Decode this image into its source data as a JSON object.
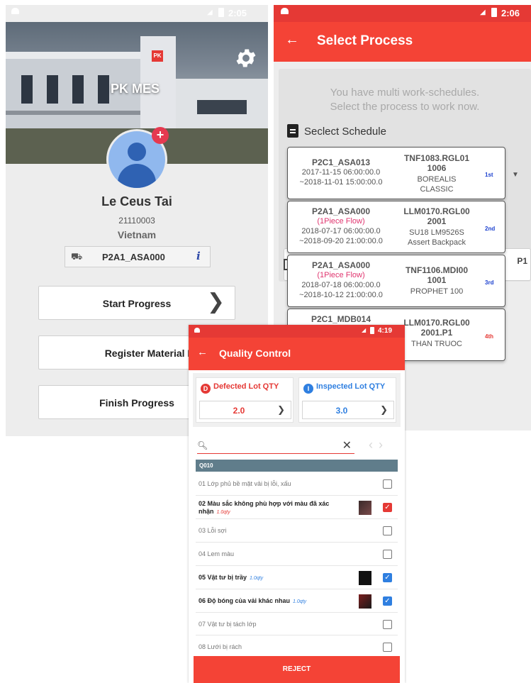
{
  "profile": {
    "status_time": "2:05",
    "app_name": "PK MES",
    "logo_text": "PK",
    "user_name": "Le Ceus Tai",
    "user_id": "21110003",
    "country": "Vietnam",
    "process": "P2A1_ASA000",
    "info_glyph": "i",
    "buttons": {
      "start": "Start Progress",
      "register": "Register Material Failure",
      "finish": "Finish Progress"
    },
    "icons": [
      "gear-icon",
      "avatar-icon",
      "add-icon",
      "machine-icon",
      "info-icon",
      "chevron-right-icon"
    ]
  },
  "select_process": {
    "status_time": "2:06",
    "title": "Select Process",
    "notice_line1": "You have multi work-schedules.",
    "notice_line2": "Select the process to work now.",
    "schedule_label": "Seclect Schedule",
    "behind_partial": "P1",
    "schedules": [
      {
        "code": "P2C1_ASA013",
        "tag": "",
        "start": "2017-11-15 06:00:00.0",
        "end": "~2018-11-01 15:00:00.0",
        "item_code": "TNF1083.RGL01",
        "item_code2": "1006",
        "desc1": "BOREALIS",
        "desc2": "CLASSIC",
        "rank": "1st",
        "rank_color": "#1a3fcf"
      },
      {
        "code": "P2A1_ASA000",
        "tag": "(1Piece Flow)",
        "start": "2018-07-17 06:00:00.0",
        "end": "~2018-09-20 21:00:00.0",
        "item_code": "LLM0170.RGL00",
        "item_code2": "2001",
        "desc1": "SU18 LM9526S",
        "desc2": "Assert Backpack",
        "rank": "2nd",
        "rank_color": "#1a3fcf"
      },
      {
        "code": "P2A1_ASA000",
        "tag": "(1Piece Flow)",
        "start": "2018-07-18 06:00:00.0",
        "end": "~2018-10-12 21:00:00.0",
        "item_code": "TNF1106.MDI00",
        "item_code2": "1001",
        "desc1": "PROPHET 100",
        "desc2": "",
        "rank": "3rd",
        "rank_color": "#1a3fcf"
      },
      {
        "code": "P2C1_MDB014",
        "tag": "",
        "start": "",
        "end": "",
        "item_code": "LLM0170.RGL00",
        "item_code2": "2001.P1",
        "desc1": "THAN TRUOC",
        "desc2": "",
        "rank": "4th",
        "rank_color": "#e53935"
      }
    ]
  },
  "quality_control": {
    "status_time": "4:19",
    "title": "Quality Control",
    "defected_label": "Defected Lot QTY",
    "defected_badge": "D",
    "defected_value": "2.0",
    "inspected_label": "Inspected Lot QTY",
    "inspected_badge": "I",
    "inspected_value": "3.0",
    "section": "Q010",
    "items": [
      {
        "text": "01 Lớp phủ bề mặt vải bị lỗi, xấu",
        "qty": "",
        "checked": false,
        "thumb": false
      },
      {
        "text": "02 Màu sắc không phù hợp với màu đã xác nhận",
        "qty": "1.0qty",
        "checked": true,
        "thumb": true,
        "color": "#e53935"
      },
      {
        "text": "03 Lỗi sợi",
        "qty": "",
        "checked": false,
        "thumb": false
      },
      {
        "text": "04 Lem màu",
        "qty": "",
        "checked": false,
        "thumb": false
      },
      {
        "text": "05 Vật tư bị trầy",
        "qty": "1.0qty",
        "checked": true,
        "thumb": true,
        "color": "#2f7fe0"
      },
      {
        "text": "06 Độ bóng của vải khác nhau",
        "qty": "1.0qty",
        "checked": true,
        "thumb": true,
        "color": "#2f7fe0"
      },
      {
        "text": "07 Vật tư bị tách lớp",
        "qty": "",
        "checked": false,
        "thumb": false
      },
      {
        "text": "08 Lưới bị rách",
        "qty": "",
        "checked": false,
        "thumb": false
      }
    ],
    "reject_label": "REJECT",
    "colors": {
      "accent": "#f44336",
      "defect": "#e53935",
      "inspect": "#2f7fe0"
    }
  }
}
